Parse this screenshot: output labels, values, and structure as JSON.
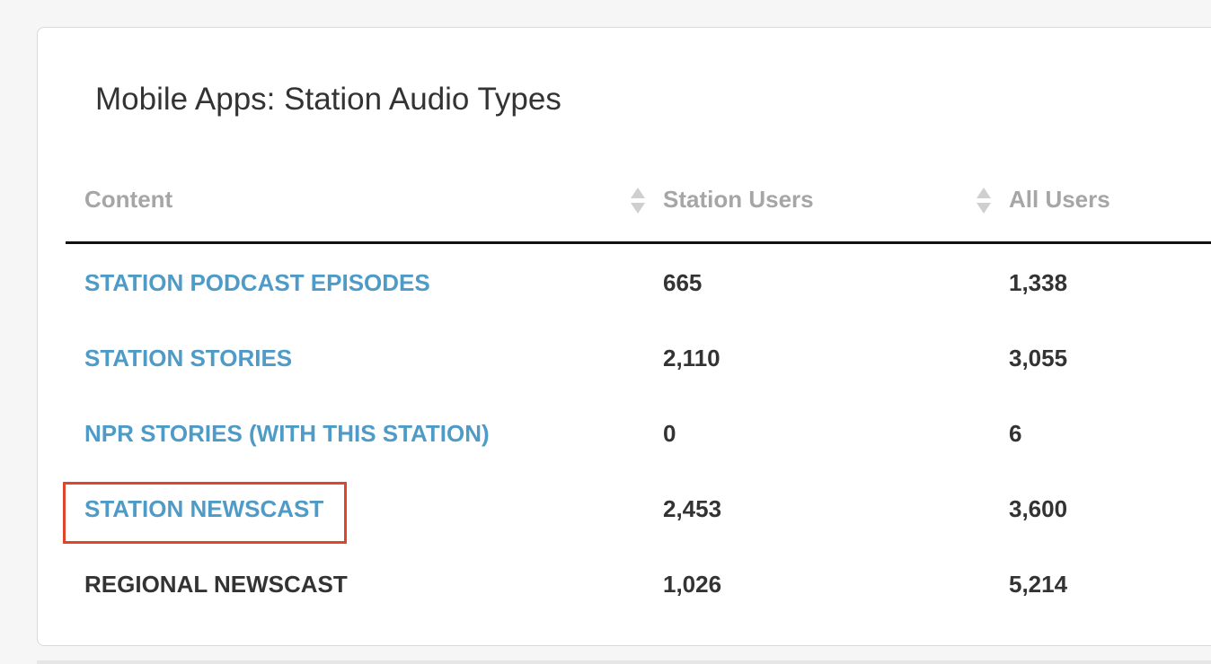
{
  "panel": {
    "title": "Mobile Apps: Station Audio Types"
  },
  "table": {
    "columns": [
      {
        "label": "Content"
      },
      {
        "label": "Station Users"
      },
      {
        "label": "All Users"
      }
    ],
    "rows": [
      {
        "content": "STATION PODCAST EPISODES",
        "station_users": "665",
        "all_users": "1,338",
        "is_link": true
      },
      {
        "content": "STATION STORIES",
        "station_users": "2,110",
        "all_users": "3,055",
        "is_link": true
      },
      {
        "content": "NPR STORIES (WITH THIS STATION)",
        "station_users": "0",
        "all_users": "6",
        "is_link": true
      },
      {
        "content": "STATION NEWSCAST",
        "station_users": "2,453",
        "all_users": "3,600",
        "is_link": true,
        "highlighted": true
      },
      {
        "content": "REGIONAL NEWSCAST",
        "station_users": "1,026",
        "all_users": "5,214",
        "is_link": false
      }
    ]
  },
  "colors": {
    "link": "#4e9bc8",
    "header_text": "#a6a6a6",
    "body_text": "#333333",
    "highlight_border": "#e0452c"
  }
}
